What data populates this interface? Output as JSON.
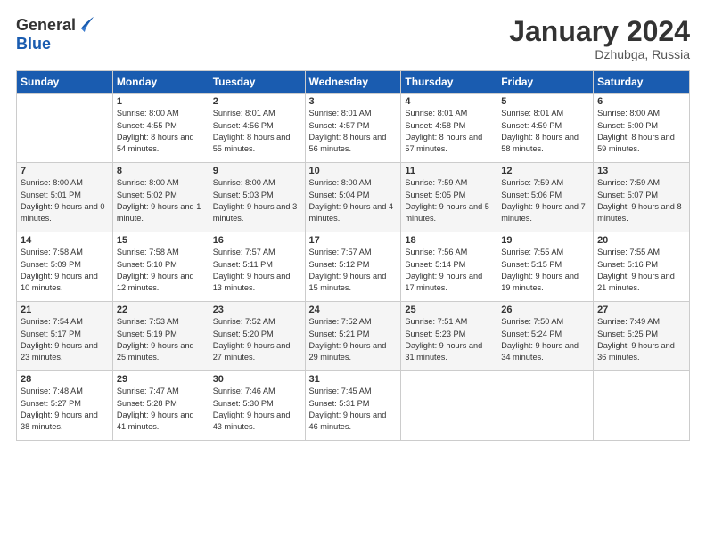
{
  "header": {
    "logo_general": "General",
    "logo_blue": "Blue",
    "month_title": "January 2024",
    "location": "Dzhubga, Russia"
  },
  "weekdays": [
    "Sunday",
    "Monday",
    "Tuesday",
    "Wednesday",
    "Thursday",
    "Friday",
    "Saturday"
  ],
  "weeks": [
    [
      {
        "day": "",
        "sunrise": "",
        "sunset": "",
        "daylight": ""
      },
      {
        "day": "1",
        "sunrise": "Sunrise: 8:00 AM",
        "sunset": "Sunset: 4:55 PM",
        "daylight": "Daylight: 8 hours and 54 minutes."
      },
      {
        "day": "2",
        "sunrise": "Sunrise: 8:01 AM",
        "sunset": "Sunset: 4:56 PM",
        "daylight": "Daylight: 8 hours and 55 minutes."
      },
      {
        "day": "3",
        "sunrise": "Sunrise: 8:01 AM",
        "sunset": "Sunset: 4:57 PM",
        "daylight": "Daylight: 8 hours and 56 minutes."
      },
      {
        "day": "4",
        "sunrise": "Sunrise: 8:01 AM",
        "sunset": "Sunset: 4:58 PM",
        "daylight": "Daylight: 8 hours and 57 minutes."
      },
      {
        "day": "5",
        "sunrise": "Sunrise: 8:01 AM",
        "sunset": "Sunset: 4:59 PM",
        "daylight": "Daylight: 8 hours and 58 minutes."
      },
      {
        "day": "6",
        "sunrise": "Sunrise: 8:00 AM",
        "sunset": "Sunset: 5:00 PM",
        "daylight": "Daylight: 8 hours and 59 minutes."
      }
    ],
    [
      {
        "day": "7",
        "sunrise": "Sunrise: 8:00 AM",
        "sunset": "Sunset: 5:01 PM",
        "daylight": "Daylight: 9 hours and 0 minutes."
      },
      {
        "day": "8",
        "sunrise": "Sunrise: 8:00 AM",
        "sunset": "Sunset: 5:02 PM",
        "daylight": "Daylight: 9 hours and 1 minute."
      },
      {
        "day": "9",
        "sunrise": "Sunrise: 8:00 AM",
        "sunset": "Sunset: 5:03 PM",
        "daylight": "Daylight: 9 hours and 3 minutes."
      },
      {
        "day": "10",
        "sunrise": "Sunrise: 8:00 AM",
        "sunset": "Sunset: 5:04 PM",
        "daylight": "Daylight: 9 hours and 4 minutes."
      },
      {
        "day": "11",
        "sunrise": "Sunrise: 7:59 AM",
        "sunset": "Sunset: 5:05 PM",
        "daylight": "Daylight: 9 hours and 5 minutes."
      },
      {
        "day": "12",
        "sunrise": "Sunrise: 7:59 AM",
        "sunset": "Sunset: 5:06 PM",
        "daylight": "Daylight: 9 hours and 7 minutes."
      },
      {
        "day": "13",
        "sunrise": "Sunrise: 7:59 AM",
        "sunset": "Sunset: 5:07 PM",
        "daylight": "Daylight: 9 hours and 8 minutes."
      }
    ],
    [
      {
        "day": "14",
        "sunrise": "Sunrise: 7:58 AM",
        "sunset": "Sunset: 5:09 PM",
        "daylight": "Daylight: 9 hours and 10 minutes."
      },
      {
        "day": "15",
        "sunrise": "Sunrise: 7:58 AM",
        "sunset": "Sunset: 5:10 PM",
        "daylight": "Daylight: 9 hours and 12 minutes."
      },
      {
        "day": "16",
        "sunrise": "Sunrise: 7:57 AM",
        "sunset": "Sunset: 5:11 PM",
        "daylight": "Daylight: 9 hours and 13 minutes."
      },
      {
        "day": "17",
        "sunrise": "Sunrise: 7:57 AM",
        "sunset": "Sunset: 5:12 PM",
        "daylight": "Daylight: 9 hours and 15 minutes."
      },
      {
        "day": "18",
        "sunrise": "Sunrise: 7:56 AM",
        "sunset": "Sunset: 5:14 PM",
        "daylight": "Daylight: 9 hours and 17 minutes."
      },
      {
        "day": "19",
        "sunrise": "Sunrise: 7:55 AM",
        "sunset": "Sunset: 5:15 PM",
        "daylight": "Daylight: 9 hours and 19 minutes."
      },
      {
        "day": "20",
        "sunrise": "Sunrise: 7:55 AM",
        "sunset": "Sunset: 5:16 PM",
        "daylight": "Daylight: 9 hours and 21 minutes."
      }
    ],
    [
      {
        "day": "21",
        "sunrise": "Sunrise: 7:54 AM",
        "sunset": "Sunset: 5:17 PM",
        "daylight": "Daylight: 9 hours and 23 minutes."
      },
      {
        "day": "22",
        "sunrise": "Sunrise: 7:53 AM",
        "sunset": "Sunset: 5:19 PM",
        "daylight": "Daylight: 9 hours and 25 minutes."
      },
      {
        "day": "23",
        "sunrise": "Sunrise: 7:52 AM",
        "sunset": "Sunset: 5:20 PM",
        "daylight": "Daylight: 9 hours and 27 minutes."
      },
      {
        "day": "24",
        "sunrise": "Sunrise: 7:52 AM",
        "sunset": "Sunset: 5:21 PM",
        "daylight": "Daylight: 9 hours and 29 minutes."
      },
      {
        "day": "25",
        "sunrise": "Sunrise: 7:51 AM",
        "sunset": "Sunset: 5:23 PM",
        "daylight": "Daylight: 9 hours and 31 minutes."
      },
      {
        "day": "26",
        "sunrise": "Sunrise: 7:50 AM",
        "sunset": "Sunset: 5:24 PM",
        "daylight": "Daylight: 9 hours and 34 minutes."
      },
      {
        "day": "27",
        "sunrise": "Sunrise: 7:49 AM",
        "sunset": "Sunset: 5:25 PM",
        "daylight": "Daylight: 9 hours and 36 minutes."
      }
    ],
    [
      {
        "day": "28",
        "sunrise": "Sunrise: 7:48 AM",
        "sunset": "Sunset: 5:27 PM",
        "daylight": "Daylight: 9 hours and 38 minutes."
      },
      {
        "day": "29",
        "sunrise": "Sunrise: 7:47 AM",
        "sunset": "Sunset: 5:28 PM",
        "daylight": "Daylight: 9 hours and 41 minutes."
      },
      {
        "day": "30",
        "sunrise": "Sunrise: 7:46 AM",
        "sunset": "Sunset: 5:30 PM",
        "daylight": "Daylight: 9 hours and 43 minutes."
      },
      {
        "day": "31",
        "sunrise": "Sunrise: 7:45 AM",
        "sunset": "Sunset: 5:31 PM",
        "daylight": "Daylight: 9 hours and 46 minutes."
      },
      {
        "day": "",
        "sunrise": "",
        "sunset": "",
        "daylight": ""
      },
      {
        "day": "",
        "sunrise": "",
        "sunset": "",
        "daylight": ""
      },
      {
        "day": "",
        "sunrise": "",
        "sunset": "",
        "daylight": ""
      }
    ]
  ]
}
